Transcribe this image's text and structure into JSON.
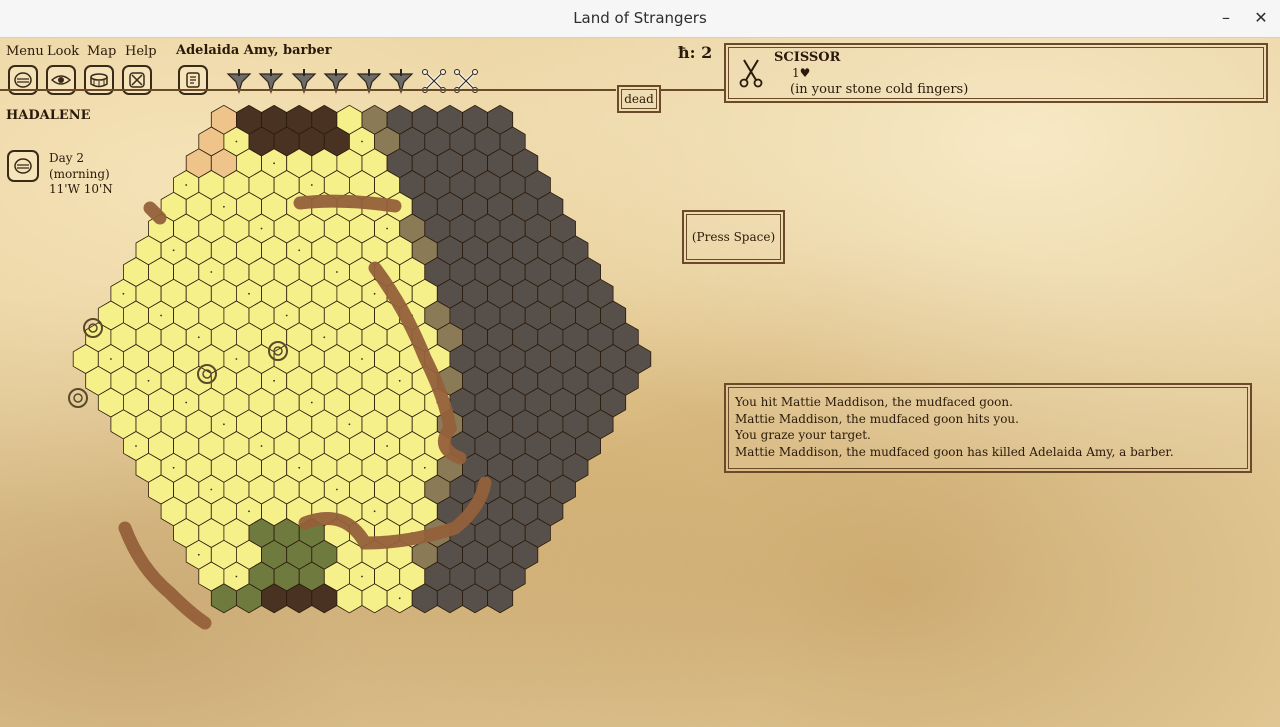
{
  "window": {
    "title": "Land of Strangers",
    "minimize": "–",
    "close": "✕"
  },
  "menu": {
    "menu": "Menu",
    "look": "Look",
    "map": "Map",
    "help": "Help"
  },
  "character": {
    "name": "Adelaida Amy, barber"
  },
  "toolbar": {
    "actions": [
      "mask-icon",
      "eye-icon",
      "drum-icon",
      "crossed-box-icon"
    ],
    "scroll": "scroll-icon",
    "inventory": [
      "dagger-icon",
      "dagger-icon",
      "dagger-icon",
      "dagger-icon",
      "dagger-icon",
      "dagger-icon",
      "crossed-bones-icon",
      "crossed-bones-icon"
    ]
  },
  "status": {
    "h_label": "ħ: 2",
    "dead": "dead"
  },
  "item": {
    "name": "SCISSOR",
    "hp": "1♥",
    "desc": "(in your stone cold fingers)",
    "icon": "scissors-icon"
  },
  "prompt": {
    "press": "(Press Space)"
  },
  "location": {
    "region": "HADALENE",
    "day": "Day 2",
    "time": "(morning)",
    "coords": "11'W 10'N"
  },
  "log": [
    "You hit Mattie Maddison, the mudfaced goon.",
    "Mattie Maddison, the mudfaced goon hits you.",
    "You graze your target.",
    "Mattie Maddison, the mudfaced goon has killed Adelaida Amy, a barber."
  ],
  "colors": {
    "ink": "#2a1a0a",
    "frame": "#6b4a2a",
    "sand": "#f6f08a",
    "fog": "#57504a",
    "road": "#93603a"
  }
}
